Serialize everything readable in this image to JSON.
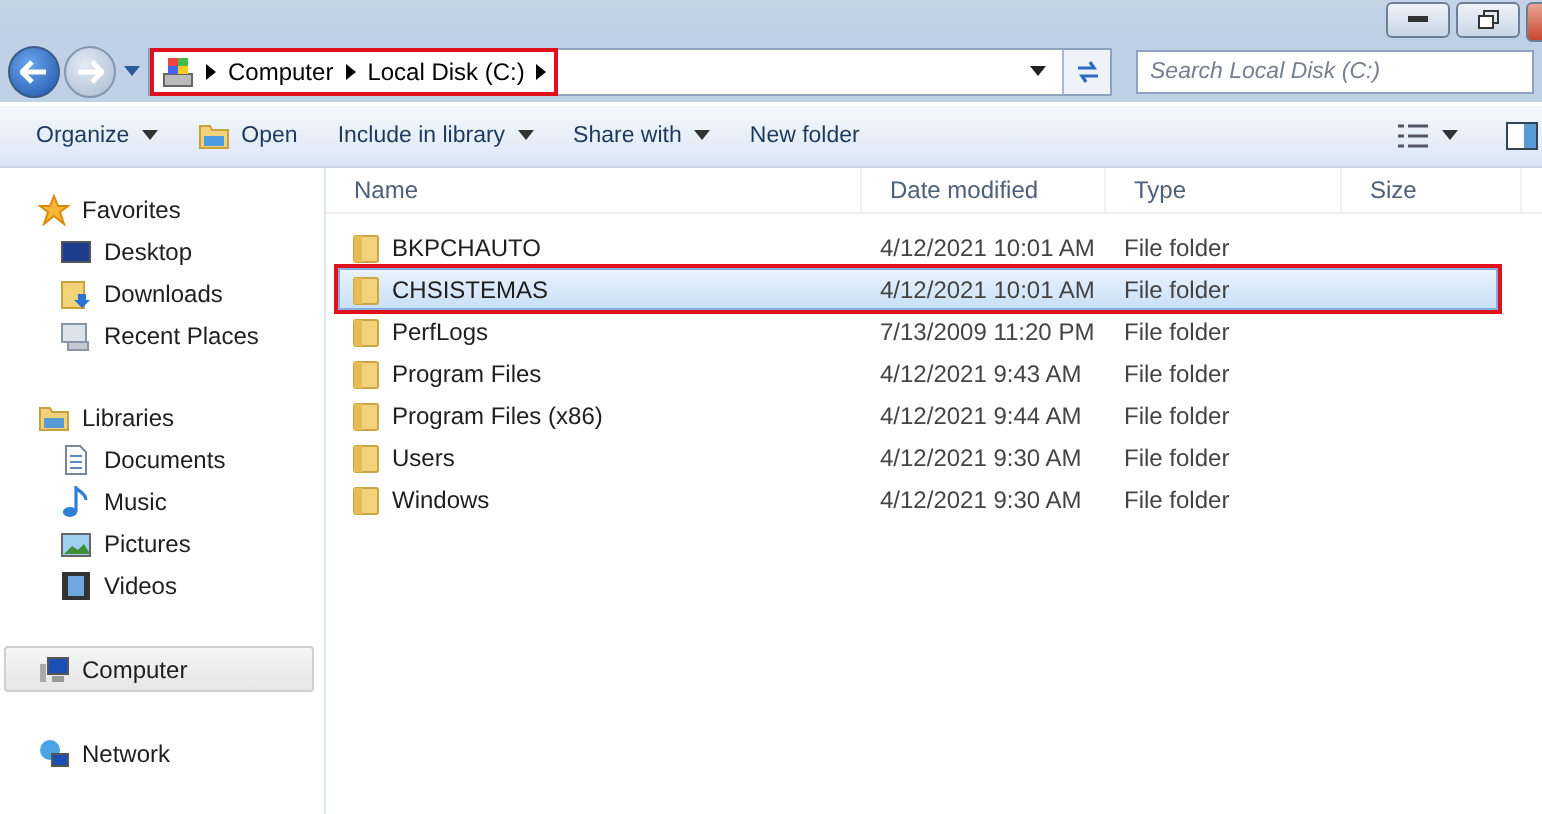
{
  "address_bar": {
    "highlighted": true,
    "crumbs": [
      "Computer",
      "Local Disk (C:)"
    ]
  },
  "search": {
    "placeholder": "Search Local Disk (C:)"
  },
  "toolbar": [
    {
      "label": "Organize",
      "kind": "menu"
    },
    {
      "label": "Open",
      "kind": "icon"
    },
    {
      "label": "Include in library",
      "kind": "menu"
    },
    {
      "label": "Share with",
      "kind": "menu"
    },
    {
      "label": "New folder",
      "kind": "plain"
    }
  ],
  "sidebar": [
    {
      "label": "Favorites",
      "selected": false,
      "children": [
        {
          "label": "Desktop",
          "selected": false
        },
        {
          "label": "Downloads",
          "selected": false
        },
        {
          "label": "Recent Places",
          "selected": false
        }
      ]
    },
    {
      "label": "Libraries",
      "selected": false,
      "children": [
        {
          "label": "Documents",
          "selected": false
        },
        {
          "label": "Music",
          "selected": false
        },
        {
          "label": "Pictures",
          "selected": false
        },
        {
          "label": "Videos",
          "selected": false
        }
      ]
    },
    {
      "label": "Computer",
      "selected": true
    },
    {
      "label": "Network",
      "selected": false
    }
  ],
  "table": {
    "columns": [
      "Name",
      "Date modified",
      "Type",
      "Size"
    ],
    "rows": [
      {
        "name": "BKPCHAUTO",
        "date": "4/12/2021 10:01 AM",
        "type": "File folder",
        "selected": false,
        "highlighted": false
      },
      {
        "name": "CHSISTEMAS",
        "date": "4/12/2021 10:01 AM",
        "type": "File folder",
        "selected": true,
        "highlighted": true
      },
      {
        "name": "PerfLogs",
        "date": "7/13/2009 11:20 PM",
        "type": "File folder",
        "selected": false,
        "highlighted": false
      },
      {
        "name": "Program Files",
        "date": "4/12/2021 9:43 AM",
        "type": "File folder",
        "selected": false,
        "highlighted": false
      },
      {
        "name": "Program Files (x86)",
        "date": "4/12/2021 9:44 AM",
        "type": "File folder",
        "selected": false,
        "highlighted": false
      },
      {
        "name": "Users",
        "date": "4/12/2021 9:30 AM",
        "type": "File folder",
        "selected": false,
        "highlighted": false
      },
      {
        "name": "Windows",
        "date": "4/12/2021 9:30 AM",
        "type": "File folder",
        "selected": false,
        "highlighted": false
      }
    ]
  }
}
